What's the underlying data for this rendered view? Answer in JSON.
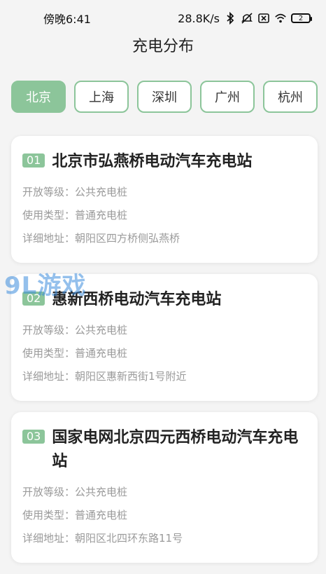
{
  "status_bar": {
    "time": "傍晚6:41",
    "network_speed": "28.8K/s",
    "battery": "2",
    "icons": [
      "bluetooth-icon",
      "mute-icon",
      "sim-off-icon",
      "wifi-icon",
      "battery-icon"
    ]
  },
  "header": {
    "title": "充电分布"
  },
  "tabs": [
    {
      "label": "北京",
      "active": true
    },
    {
      "label": "上海",
      "active": false
    },
    {
      "label": "深圳",
      "active": false
    },
    {
      "label": "广州",
      "active": false
    },
    {
      "label": "杭州",
      "active": false
    }
  ],
  "stations": [
    {
      "index": "01",
      "name": "北京市弘燕桥电动汽车充电站",
      "level_label": "开放等级：",
      "level": "公共充电桩",
      "type_label": "使用类型：",
      "type": "普通充电桩",
      "address_label": "详细地址：",
      "address": "朝阳区四方桥侧弘燕桥"
    },
    {
      "index": "02",
      "name": "惠新西桥电动汽车充电站",
      "level_label": "开放等级：",
      "level": "公共充电桩",
      "type_label": "使用类型：",
      "type": "普通充电桩",
      "address_label": "详细地址：",
      "address": "朝阳区惠新西街1号附近"
    },
    {
      "index": "03",
      "name": "国家电网北京四元西桥电动汽车充电站",
      "level_label": "开放等级：",
      "level": "公共充电桩",
      "type_label": "使用类型：",
      "type": "普通充电桩",
      "address_label": "详细地址：",
      "address": "朝阳区北四环东路11号"
    }
  ],
  "watermark": "9L游戏",
  "colors": {
    "accent": "#8cc59a",
    "background": "#f4f4f4",
    "muted_text": "#9a9a9a"
  }
}
